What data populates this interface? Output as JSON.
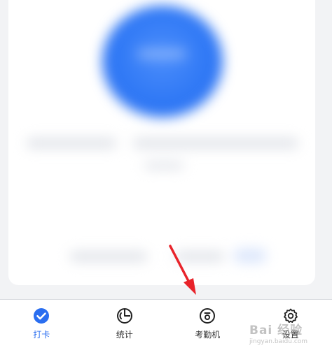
{
  "tabbar": {
    "active_index": 0,
    "active_color": "#2a6ef0",
    "items": [
      {
        "label": "打卡",
        "icon": "check-circle-icon"
      },
      {
        "label": "统计",
        "icon": "pie-chart-icon"
      },
      {
        "label": "考勤机",
        "icon": "attendance-machine-icon"
      },
      {
        "label": "设置",
        "icon": "gear-icon"
      }
    ]
  },
  "watermark": {
    "main": "Bai 经验",
    "sub": "jingyan.baidu.com"
  },
  "colors": {
    "punch_button": "#2f78f5",
    "arrow": "#e8232a"
  }
}
